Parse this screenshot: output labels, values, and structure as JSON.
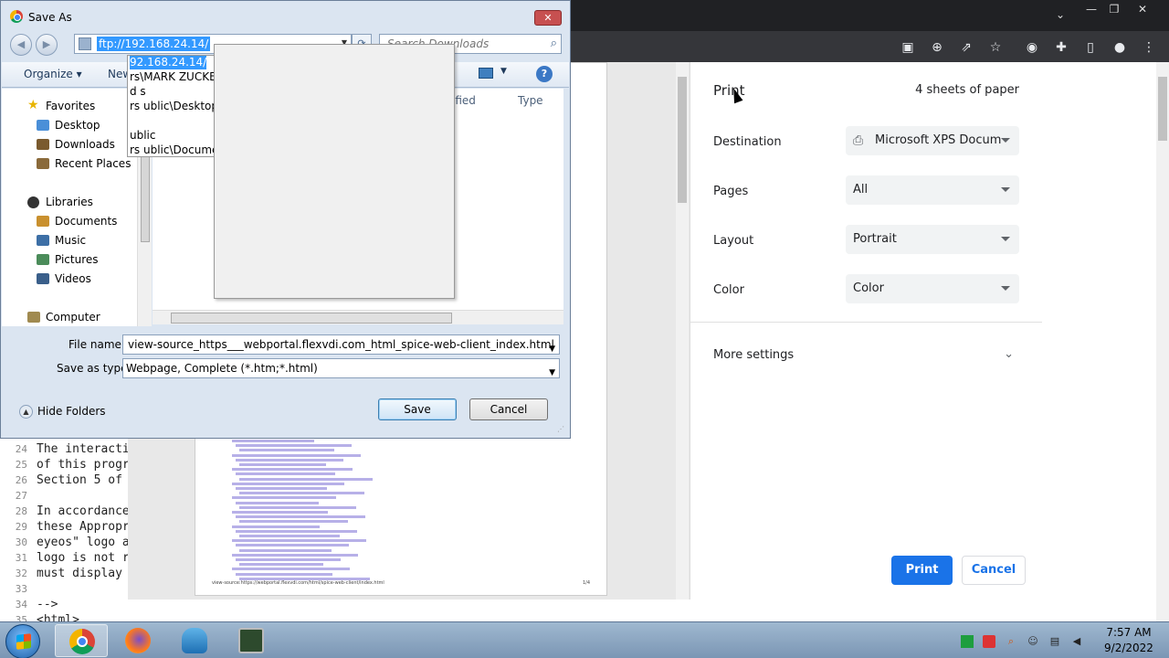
{
  "browser": {
    "window_controls": {
      "chevron": "⌄",
      "minimize": "—",
      "restore": "❐",
      "close": "✕"
    },
    "toolbar_icons": [
      "translate-icon",
      "zoom-icon",
      "share-icon",
      "bookmark-star-icon",
      "profile-icon",
      "extensions-icon",
      "side-panel-icon",
      "account-icon",
      "menu-icon"
    ]
  },
  "source_lines": [
    {
      "num": "24",
      "text": "The interacti"
    },
    {
      "num": "25",
      "text": "of this progr"
    },
    {
      "num": "26",
      "text": "Section 5 of"
    },
    {
      "num": "27",
      "text": ""
    },
    {
      "num": "28",
      "text": "In accordance"
    },
    {
      "num": "29",
      "text": "these Appropr"
    },
    {
      "num": "30",
      "text": "eyeos\" logo a"
    },
    {
      "num": "31",
      "text": "logo is not r"
    },
    {
      "num": "32",
      "text": "must display"
    },
    {
      "num": "33",
      "text": ""
    },
    {
      "num": "34",
      "text": "-->"
    },
    {
      "num": "35",
      "text": "<html>"
    }
  ],
  "print": {
    "title": "Print",
    "sheets": "4 sheets of paper",
    "destination_label": "Destination",
    "destination_value": "Microsoft XPS Docum",
    "pages_label": "Pages",
    "pages_value": "All",
    "layout_label": "Layout",
    "layout_value": "Portrait",
    "color_label": "Color",
    "color_value": "Color",
    "more_settings": "More settings",
    "print_button": "Print",
    "cancel_button": "Cancel",
    "preview_footer_url": "view-source:https://webportal.flexvdi.com/html/spice-web-client/index.html",
    "preview_footer_page": "1/4"
  },
  "dialog": {
    "title": "Save As",
    "close": "✕",
    "address_value": "ftp://192.168.24.14/",
    "search_placeholder": "Search Downloads",
    "organize": "Organize ▾",
    "new_folder": "New",
    "col_modified": "ified",
    "col_type": "Type",
    "nav": {
      "favorites": "Favorites",
      "desktop": "Desktop",
      "downloads": "Downloads",
      "recent_places": "Recent Places",
      "libraries": "Libraries",
      "documents": "Documents",
      "music": "Music",
      "pictures": "Pictures",
      "videos": "Videos",
      "computer": "Computer"
    },
    "address_history": [
      "92.168.24.14/",
      "rs\\MARK ZUCKER",
      "d  s",
      "rs  ublic\\Desktop",
      "",
      "  ublic",
      "rs  ublic\\Docume"
    ],
    "filename_label": "File name:",
    "filename_value": "view-source_https___webportal.flexvdi.com_html_spice-web-client_index.html",
    "savetype_label": "Save as type:",
    "savetype_value": "Webpage, Complete (*.htm;*.html)",
    "hide_folders": "Hide Folders",
    "save_button": "Save",
    "cancel_button": "Cancel"
  },
  "taskbar": {
    "time": "7:57 AM",
    "date": "9/2/2022"
  },
  "colors": {
    "accent": "#1a73e8",
    "dialog_bg": "#dbe5f1",
    "taskbar": "#8ba6c2"
  }
}
